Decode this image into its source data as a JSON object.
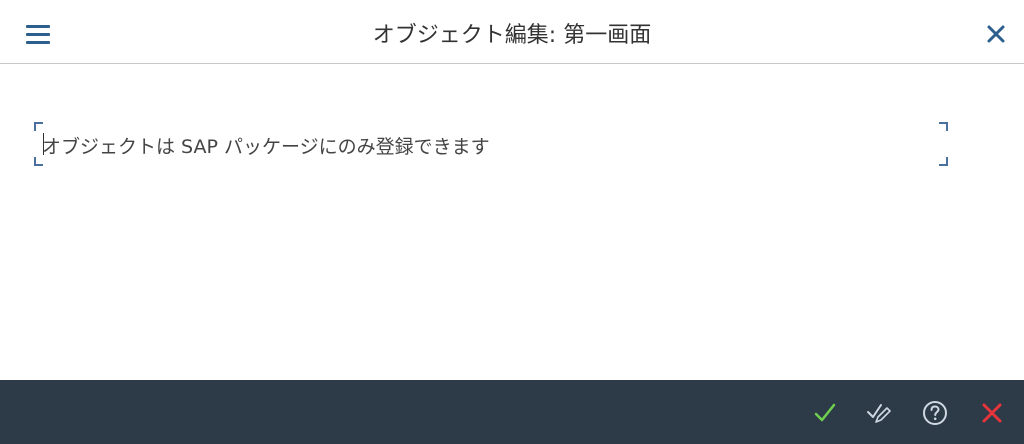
{
  "window": {
    "title": "オブジェクト編集: 第一画面"
  },
  "message": {
    "text": "オブジェクトは SAP パッケージにのみ登録できます"
  },
  "icons": {
    "menu": "hamburger-menu-icon",
    "close": "close-icon",
    "continue": "checkmark-icon",
    "continue_all": "checkmark-edit-icon",
    "help": "help-icon",
    "cancel": "cancel-icon"
  },
  "colors": {
    "icon_blue": "#2d5f8e",
    "footer_bg": "#2d3a47",
    "ok_green": "#6fcf4f",
    "cancel_red": "#e5343b",
    "frame_blue": "#4a6fa0"
  }
}
